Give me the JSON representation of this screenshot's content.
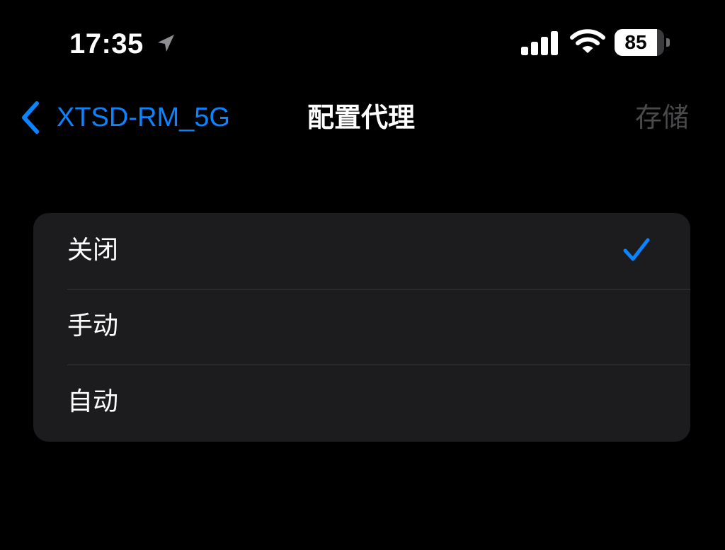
{
  "status_bar": {
    "time": "17:35",
    "battery_level": "85",
    "battery_fraction": 0.85,
    "icons": [
      "location-arrow-icon",
      "cellular-signal-icon",
      "wifi-icon",
      "battery-icon"
    ]
  },
  "nav": {
    "back_label": "XTSD-RM_5G",
    "title": "配置代理",
    "save_label": "存储"
  },
  "options": [
    {
      "label": "关闭",
      "selected": true
    },
    {
      "label": "手动",
      "selected": false
    },
    {
      "label": "自动",
      "selected": false
    }
  ],
  "colors": {
    "background": "#000000",
    "group_background": "#1c1c1e",
    "accent": "#0a84ff",
    "disabled_text": "#4a4a4d",
    "separator": "#38383a"
  }
}
